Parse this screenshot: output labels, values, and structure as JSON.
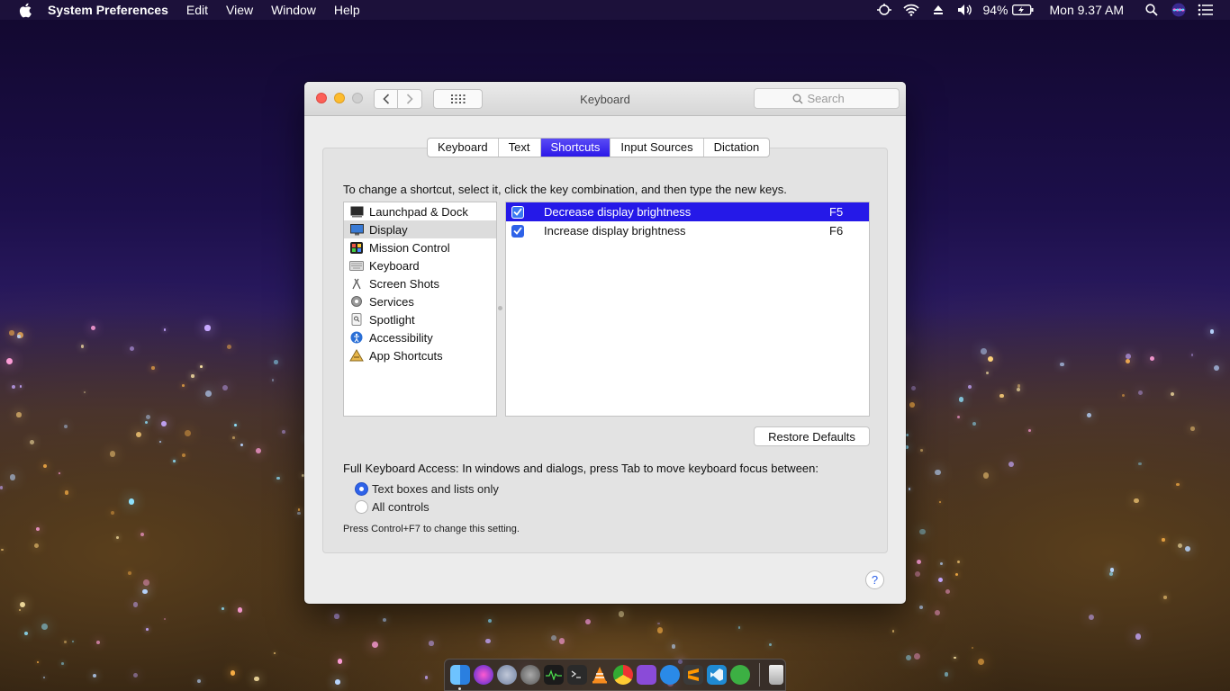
{
  "menubar": {
    "apple_icon": "apple-logo",
    "app_name": "System Preferences",
    "menus": [
      "Edit",
      "View",
      "Window",
      "Help"
    ],
    "status_icons": [
      "remote-desktop-icon",
      "wifi-icon",
      "eject-icon",
      "volume-icon"
    ],
    "battery_percent": "94%",
    "clock": "Mon 9.37 AM",
    "right_icons": [
      "spotlight-search-icon",
      "siri-icon",
      "notification-center-icon"
    ]
  },
  "window": {
    "title": "Keyboard",
    "search_placeholder": "Search",
    "tabs": [
      {
        "label": "Keyboard",
        "active": false
      },
      {
        "label": "Text",
        "active": false
      },
      {
        "label": "Shortcuts",
        "active": true
      },
      {
        "label": "Input Sources",
        "active": false
      },
      {
        "label": "Dictation",
        "active": false
      }
    ],
    "instruction": "To change a shortcut, select it, click the key combination, and then type the new keys.",
    "categories": [
      {
        "label": "Launchpad & Dock",
        "icon": "launchpad-icon",
        "selected": false
      },
      {
        "label": "Display",
        "icon": "display-icon",
        "selected": true
      },
      {
        "label": "Mission Control",
        "icon": "mission-control-icon",
        "selected": false
      },
      {
        "label": "Keyboard",
        "icon": "keyboard-icon",
        "selected": false
      },
      {
        "label": "Screen Shots",
        "icon": "screenshot-icon",
        "selected": false
      },
      {
        "label": "Services",
        "icon": "gear-icon",
        "selected": false
      },
      {
        "label": "Spotlight",
        "icon": "spotlight-icon",
        "selected": false
      },
      {
        "label": "Accessibility",
        "icon": "accessibility-icon",
        "selected": false
      },
      {
        "label": "App Shortcuts",
        "icon": "app-shortcuts-icon",
        "selected": false
      }
    ],
    "shortcuts": [
      {
        "label": "Decrease display brightness",
        "key": "F5",
        "checked": true,
        "selected": true
      },
      {
        "label": "Increase display brightness",
        "key": "F6",
        "checked": true,
        "selected": false
      }
    ],
    "restore_button": "Restore Defaults",
    "full_keyboard_access": "Full Keyboard Access: In windows and dialogs, press Tab to move keyboard focus between:",
    "radio_options": [
      {
        "label": "Text boxes and lists only",
        "selected": true
      },
      {
        "label": "All controls",
        "selected": false
      }
    ],
    "note": "Press Control+F7 to change this setting.",
    "help_label": "?"
  },
  "dock": {
    "apps": [
      "finder-icon",
      "siri-icon",
      "launchpad-icon",
      "system-preferences-icon",
      "activity-monitor-icon",
      "terminal-icon",
      "vlc-icon",
      "chrome-icon",
      "github-desktop-icon",
      "internet-explorer-icon",
      "sublime-text-icon",
      "vscode-icon",
      "robinhood-icon",
      "trash-icon"
    ]
  },
  "colors": {
    "selection_blue": "#2519e8",
    "tab_active": "#2b18e8",
    "checkbox_blue": "#2e62e8"
  }
}
